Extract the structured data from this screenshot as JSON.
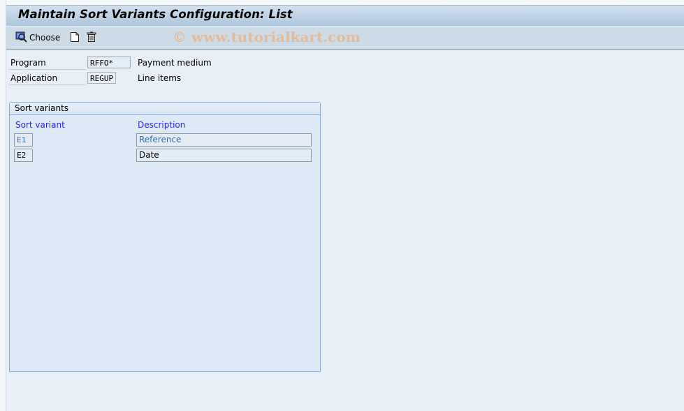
{
  "window": {
    "title": "Maintain Sort Variants Configuration: List"
  },
  "toolbar": {
    "choose_label": "Choose",
    "icons": [
      "choose-magnifier-icon",
      "new-document-icon",
      "trash-delete-icon"
    ]
  },
  "watermark": "© www.tutorialkart.com",
  "header_fields": [
    {
      "label": "Program",
      "value": "RFFO*",
      "description": "Payment medium"
    },
    {
      "label": "Application",
      "value": "REGUP",
      "description": "Line items"
    }
  ],
  "sort_variants": {
    "group_title": "Sort variants",
    "columns": [
      "Sort variant",
      "Description"
    ],
    "rows": [
      {
        "variant": "E1",
        "description": "Reference"
      },
      {
        "variant": "E2",
        "description": "Date"
      }
    ]
  },
  "colors": {
    "title_bar": "#aec5dd",
    "toolbar": "#cddbe7",
    "background": "#e8eff7",
    "column_header": "#2a2adc",
    "selected_text": "#2a6fb8",
    "watermark": "#e8b68c"
  }
}
